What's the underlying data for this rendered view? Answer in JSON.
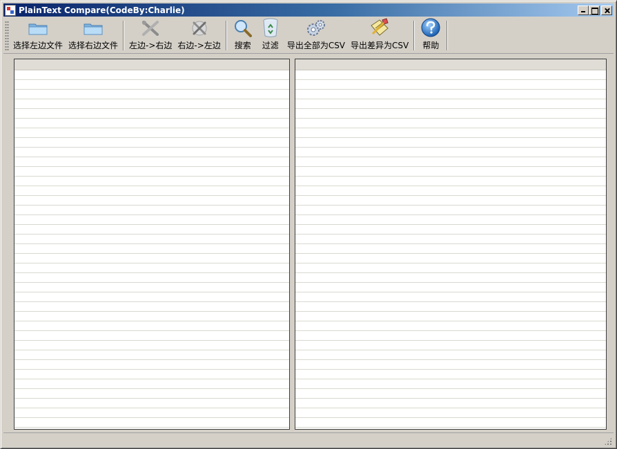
{
  "window": {
    "title": "PlainText Compare(CodeBy:Charlie)"
  },
  "toolbar": {
    "buttons": [
      {
        "label": "选择左边文件",
        "icon": "folder-open-icon"
      },
      {
        "label": "选择右边文件",
        "icon": "folder-open-icon"
      },
      {
        "label": "左边->右边",
        "icon": "tools-icon"
      },
      {
        "label": "右边->左边",
        "icon": "tools-icon"
      },
      {
        "label": "搜索",
        "icon": "magnifier-icon"
      },
      {
        "label": "过滤",
        "icon": "recycle-bin-icon"
      },
      {
        "label": "导出全部为CSV",
        "icon": "gears-icon"
      },
      {
        "label": "导出差异为CSV",
        "icon": "pencil-notepad-icon"
      },
      {
        "label": "帮助",
        "icon": "help-globe-icon"
      }
    ]
  },
  "colors": {
    "titlebar_start": "#0a246a",
    "titlebar_end": "#a6caf0",
    "window_bg": "#d4d0c8",
    "pane_bg": "#ffffff",
    "pane_line": "#d8d8d0"
  }
}
